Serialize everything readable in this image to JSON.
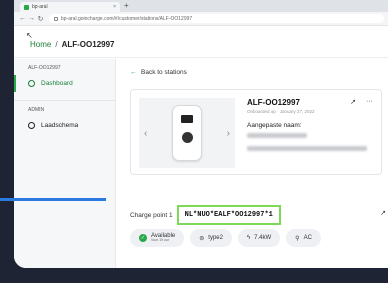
{
  "browser": {
    "tab_title": "bp-aral",
    "new_tab_icon": "plus",
    "url": "bp-aral.goincharge.com/#/customer/stations/ALF-OO12997"
  },
  "header": {
    "home": "Home",
    "separator": "/",
    "current": "ALF-OO12997"
  },
  "sidebar": {
    "section1": "ALF-OO12997",
    "items": [
      {
        "label": "Dashboard",
        "icon": "location-pin-icon",
        "active": true
      }
    ],
    "section2": "ADMIN",
    "items2": [
      {
        "label": "Laadschema",
        "icon": "clock-icon",
        "active": false
      }
    ]
  },
  "main": {
    "back_label": "Back to stations",
    "station": {
      "title": "ALF-OO12997",
      "subtitle": "Onboarded op · January 27, 2022",
      "custom_name_label": "Aangepaste naam:"
    },
    "charge_point_label": "Charge point 1",
    "charge_point_id": "NL*NUO*EALF*OO12997*1",
    "chips": [
      {
        "label": "Available",
        "sub": "Voor 19 uur",
        "icon": "check-icon"
      },
      {
        "label": "type2",
        "icon": "plug-icon"
      },
      {
        "label": "7.4kW",
        "icon": "bolt-icon"
      },
      {
        "label": "AC",
        "icon": "pin-icon"
      }
    ]
  },
  "colors": {
    "accent": "#2aa84a",
    "highlight": "#7ed957",
    "annotation": "#2b7bde"
  }
}
